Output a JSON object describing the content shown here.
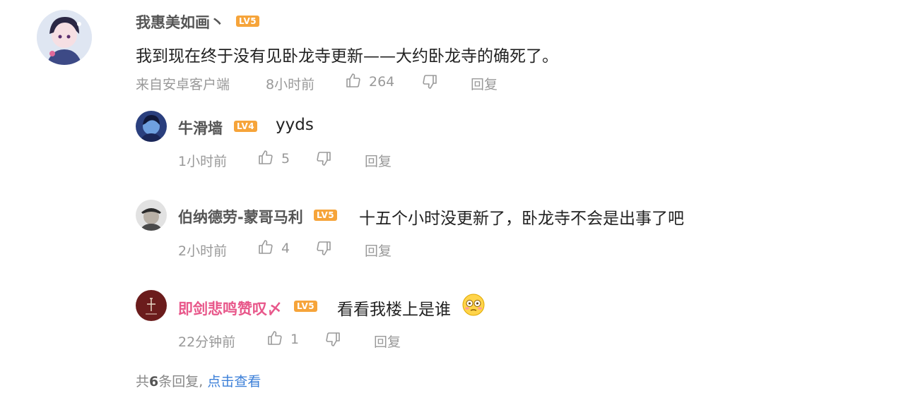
{
  "main_comment": {
    "username": "我惠美如画丶",
    "level": "LV5",
    "text": "我到现在终于没有见卧龙寺更新——大约卧龙寺的确死了。",
    "source": "来自安卓客户端",
    "time": "8小时前",
    "likes": "264",
    "reply_label": "回复"
  },
  "replies": [
    {
      "username": "牛滑墙",
      "level": "LV4",
      "text": "yyds",
      "time": "1小时前",
      "likes": "5",
      "reply_label": "回复"
    },
    {
      "username": "伯纳德劳-蒙哥马利",
      "level": "LV5",
      "text": "十五个小时没更新了，卧龙寺不会是出事了吧",
      "time": "2小时前",
      "likes": "4",
      "reply_label": "回复"
    },
    {
      "username": "即剑悲鸣赞叹〆",
      "level": "LV5",
      "text": "看看我楼上是谁",
      "time": "22分钟前",
      "likes": "1",
      "reply_label": "回复"
    }
  ],
  "footer": {
    "total_prefix": "共",
    "total_count": "6",
    "total_suffix": "条回复,",
    "view_link": "点击查看"
  },
  "colors": {
    "level_badge": "#f6a43a",
    "pink_username": "#e8578a",
    "link": "#3b7fd8"
  },
  "icons": [
    "thumbs-up-icon",
    "thumbs-down-icon",
    "flushed-emoji-icon"
  ]
}
